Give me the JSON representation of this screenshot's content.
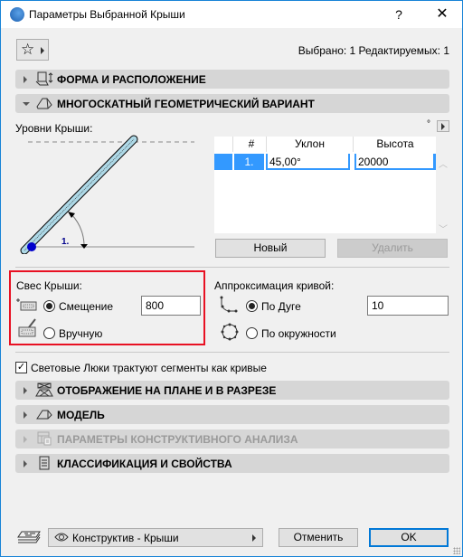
{
  "window": {
    "title": "Параметры Выбранной Крыши",
    "help_label": "?",
    "close_label": "✕"
  },
  "toolbar": {
    "favorites_icon": "star-icon",
    "selected_info": "Выбрано: 1 Редактируемых: 1"
  },
  "panels": [
    {
      "label": "ФОРМА И РАСПОЛОЖЕНИЕ",
      "expanded": false,
      "enabled": true,
      "icon": "shape-position-icon"
    },
    {
      "label": "МНОГОСКАТНЫЙ ГЕОМЕТРИЧЕСКИЙ ВАРИАНТ",
      "expanded": true,
      "enabled": true,
      "icon": "multi-plane-roof-icon"
    },
    {
      "label": "ОТОБРАЖЕНИЕ НА ПЛАНЕ И В РАЗРЕЗЕ",
      "expanded": false,
      "enabled": true,
      "icon": "floor-plan-section-icon"
    },
    {
      "label": "МОДЕЛЬ",
      "expanded": false,
      "enabled": true,
      "icon": "model-icon"
    },
    {
      "label": "ПАРАМЕТРЫ КОНСТРУКТИВНОГО АНАЛИЗА",
      "expanded": false,
      "enabled": false,
      "icon": "structural-analysis-icon"
    },
    {
      "label": "КЛАССИФИКАЦИЯ И СВОЙСТВА",
      "expanded": false,
      "enabled": true,
      "icon": "classification-icon"
    }
  ],
  "roof_levels": {
    "label": "Уровни Крыши:",
    "degree_mark": "°",
    "diagram_level_label": "1.",
    "table": {
      "columns": [
        "#",
        "Уклон",
        "Высота"
      ],
      "rows": [
        {
          "num": "1.",
          "pitch": "45,00°",
          "height": "20000",
          "selected": true
        }
      ]
    },
    "new_button": "Новый",
    "delete_button": "Удалить",
    "delete_enabled": false
  },
  "eaves": {
    "label": "Свес Крыши:",
    "options": [
      {
        "label": "Смещение",
        "selected": true
      },
      {
        "label": "Вручную",
        "selected": false
      }
    ],
    "offset_value": "800"
  },
  "curve_approx": {
    "label": "Аппроксимация кривой:",
    "options": [
      {
        "label": "По Дуге",
        "selected": true
      },
      {
        "label": "По окружности",
        "selected": false
      }
    ],
    "value": "10"
  },
  "skylights_checkbox": {
    "label": "Световые Люки трактуют сегменты как кривые",
    "checked": true
  },
  "footer": {
    "layer_dropdown": "Конструктив - Крыши",
    "cancel_button": "Отменить",
    "ok_button": "OK"
  },
  "colors": {
    "accent": "#0078d7",
    "selected_row": "#3399ff",
    "highlight_box": "#e81123",
    "roof_fill": "#add8e6",
    "pivot_dot": "#0000cc"
  }
}
